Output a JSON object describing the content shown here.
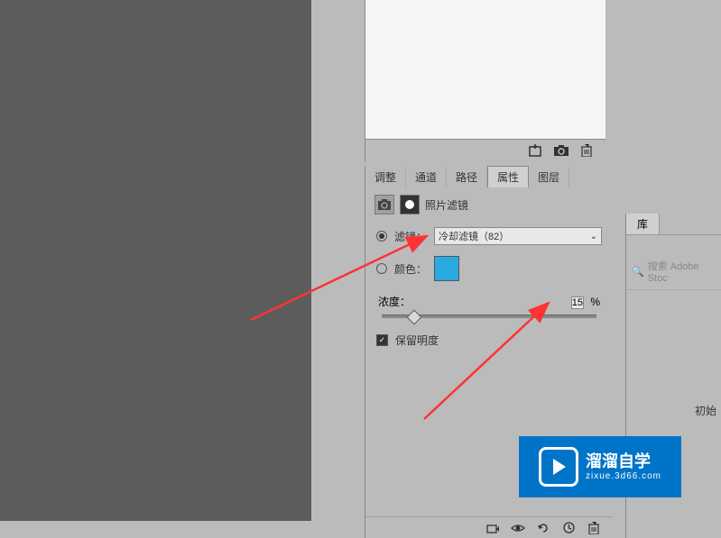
{
  "doc_footer": {
    "icon1": "new-file-icon",
    "icon2": "camera-icon",
    "icon3": "trash-icon"
  },
  "tabs": {
    "adjust": "调整",
    "channel": "通道",
    "path": "路径",
    "properties": "属性",
    "layers": "图层"
  },
  "prop": {
    "title": "照片滤镜",
    "filter_label": "滤镜：",
    "filter_value": "冷却滤镜（82）",
    "color_label": "颜色：",
    "density_label": "浓度：",
    "density_value": "15",
    "density_unit": "%",
    "preserve_label": "保留明度"
  },
  "right": {
    "tab_lib": "库",
    "search_placeholder": "搜索 Adobe Stoc",
    "init_text": "初始"
  },
  "watermark": {
    "brand": "溜溜自学",
    "url": "zixue.3d66.com"
  }
}
